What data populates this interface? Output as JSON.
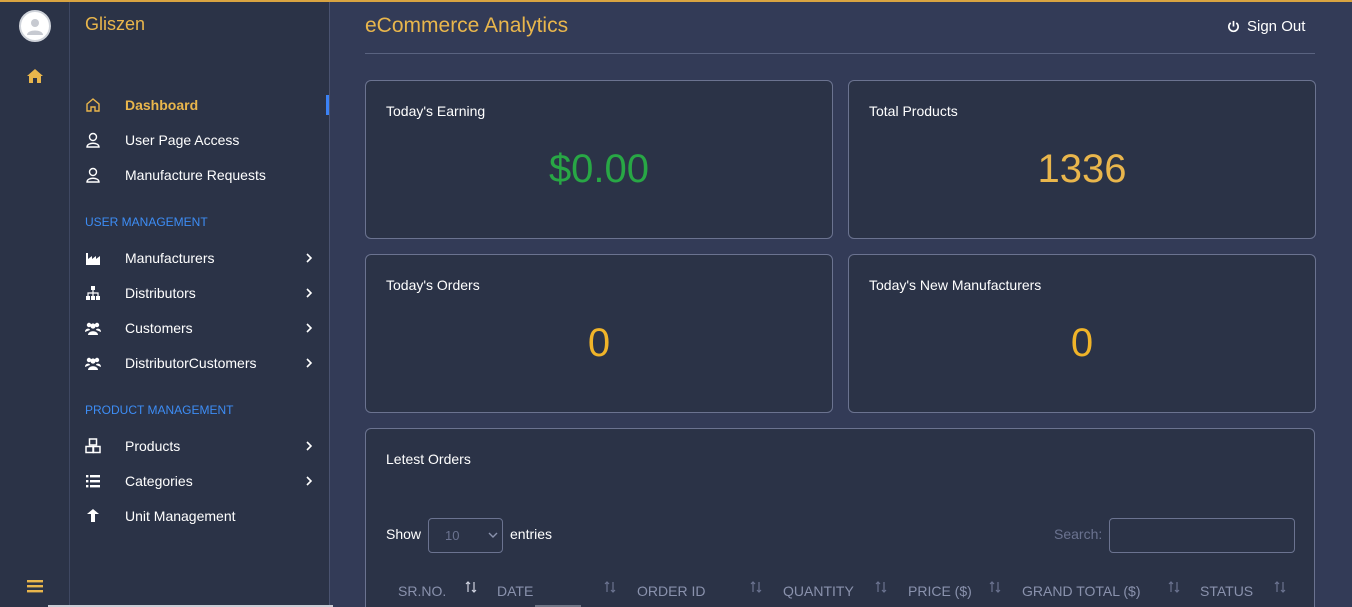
{
  "brand": "Gliszen",
  "page_title": "eCommerce Analytics",
  "header": {
    "signout_label": "Sign Out"
  },
  "colors": {
    "accent": "#e9b64c",
    "section": "#3d8df5",
    "green": "#28a745",
    "sidebar_bg": "#2b3347",
    "page_bg": "#333b57"
  },
  "sidebar": {
    "items": [
      {
        "label": "Dashboard",
        "icon": "home-outline-icon",
        "active": true
      },
      {
        "label": "User Page Access",
        "icon": "user-access-icon"
      },
      {
        "label": "Manufacture Requests",
        "icon": "user-request-icon"
      }
    ],
    "sections": [
      {
        "title": "USER MANAGEMENT",
        "items": [
          {
            "label": "Manufacturers",
            "icon": "factory-icon"
          },
          {
            "label": "Distributors",
            "icon": "sitemap-icon"
          },
          {
            "label": "Customers",
            "icon": "users-icon"
          },
          {
            "label": "DistributorCustomers",
            "icon": "users-icon"
          }
        ]
      },
      {
        "title": "PRODUCT MANAGEMENT",
        "items": [
          {
            "label": "Products",
            "icon": "cubes-icon"
          },
          {
            "label": "Categories",
            "icon": "list-icon"
          },
          {
            "label": "Unit Management",
            "icon": "unit-icon"
          }
        ]
      }
    ]
  },
  "cards": [
    {
      "title": "Today's Earning",
      "value": "$0.00"
    },
    {
      "title": "Total Products",
      "value": "1336"
    },
    {
      "title": "Today's Orders",
      "value": "0"
    },
    {
      "title": "Today's New Manufacturers",
      "value": "0"
    }
  ],
  "orders": {
    "title": "Letest Orders",
    "show_label": "Show",
    "entries_value": "10",
    "entries_label": "entries",
    "search_label": "Search:",
    "columns": [
      "SR.NO.",
      "DATE",
      "ORDER ID",
      "QUANTITY",
      "PRICE ($)",
      "GRAND TOTAL ($)",
      "STATUS"
    ]
  }
}
